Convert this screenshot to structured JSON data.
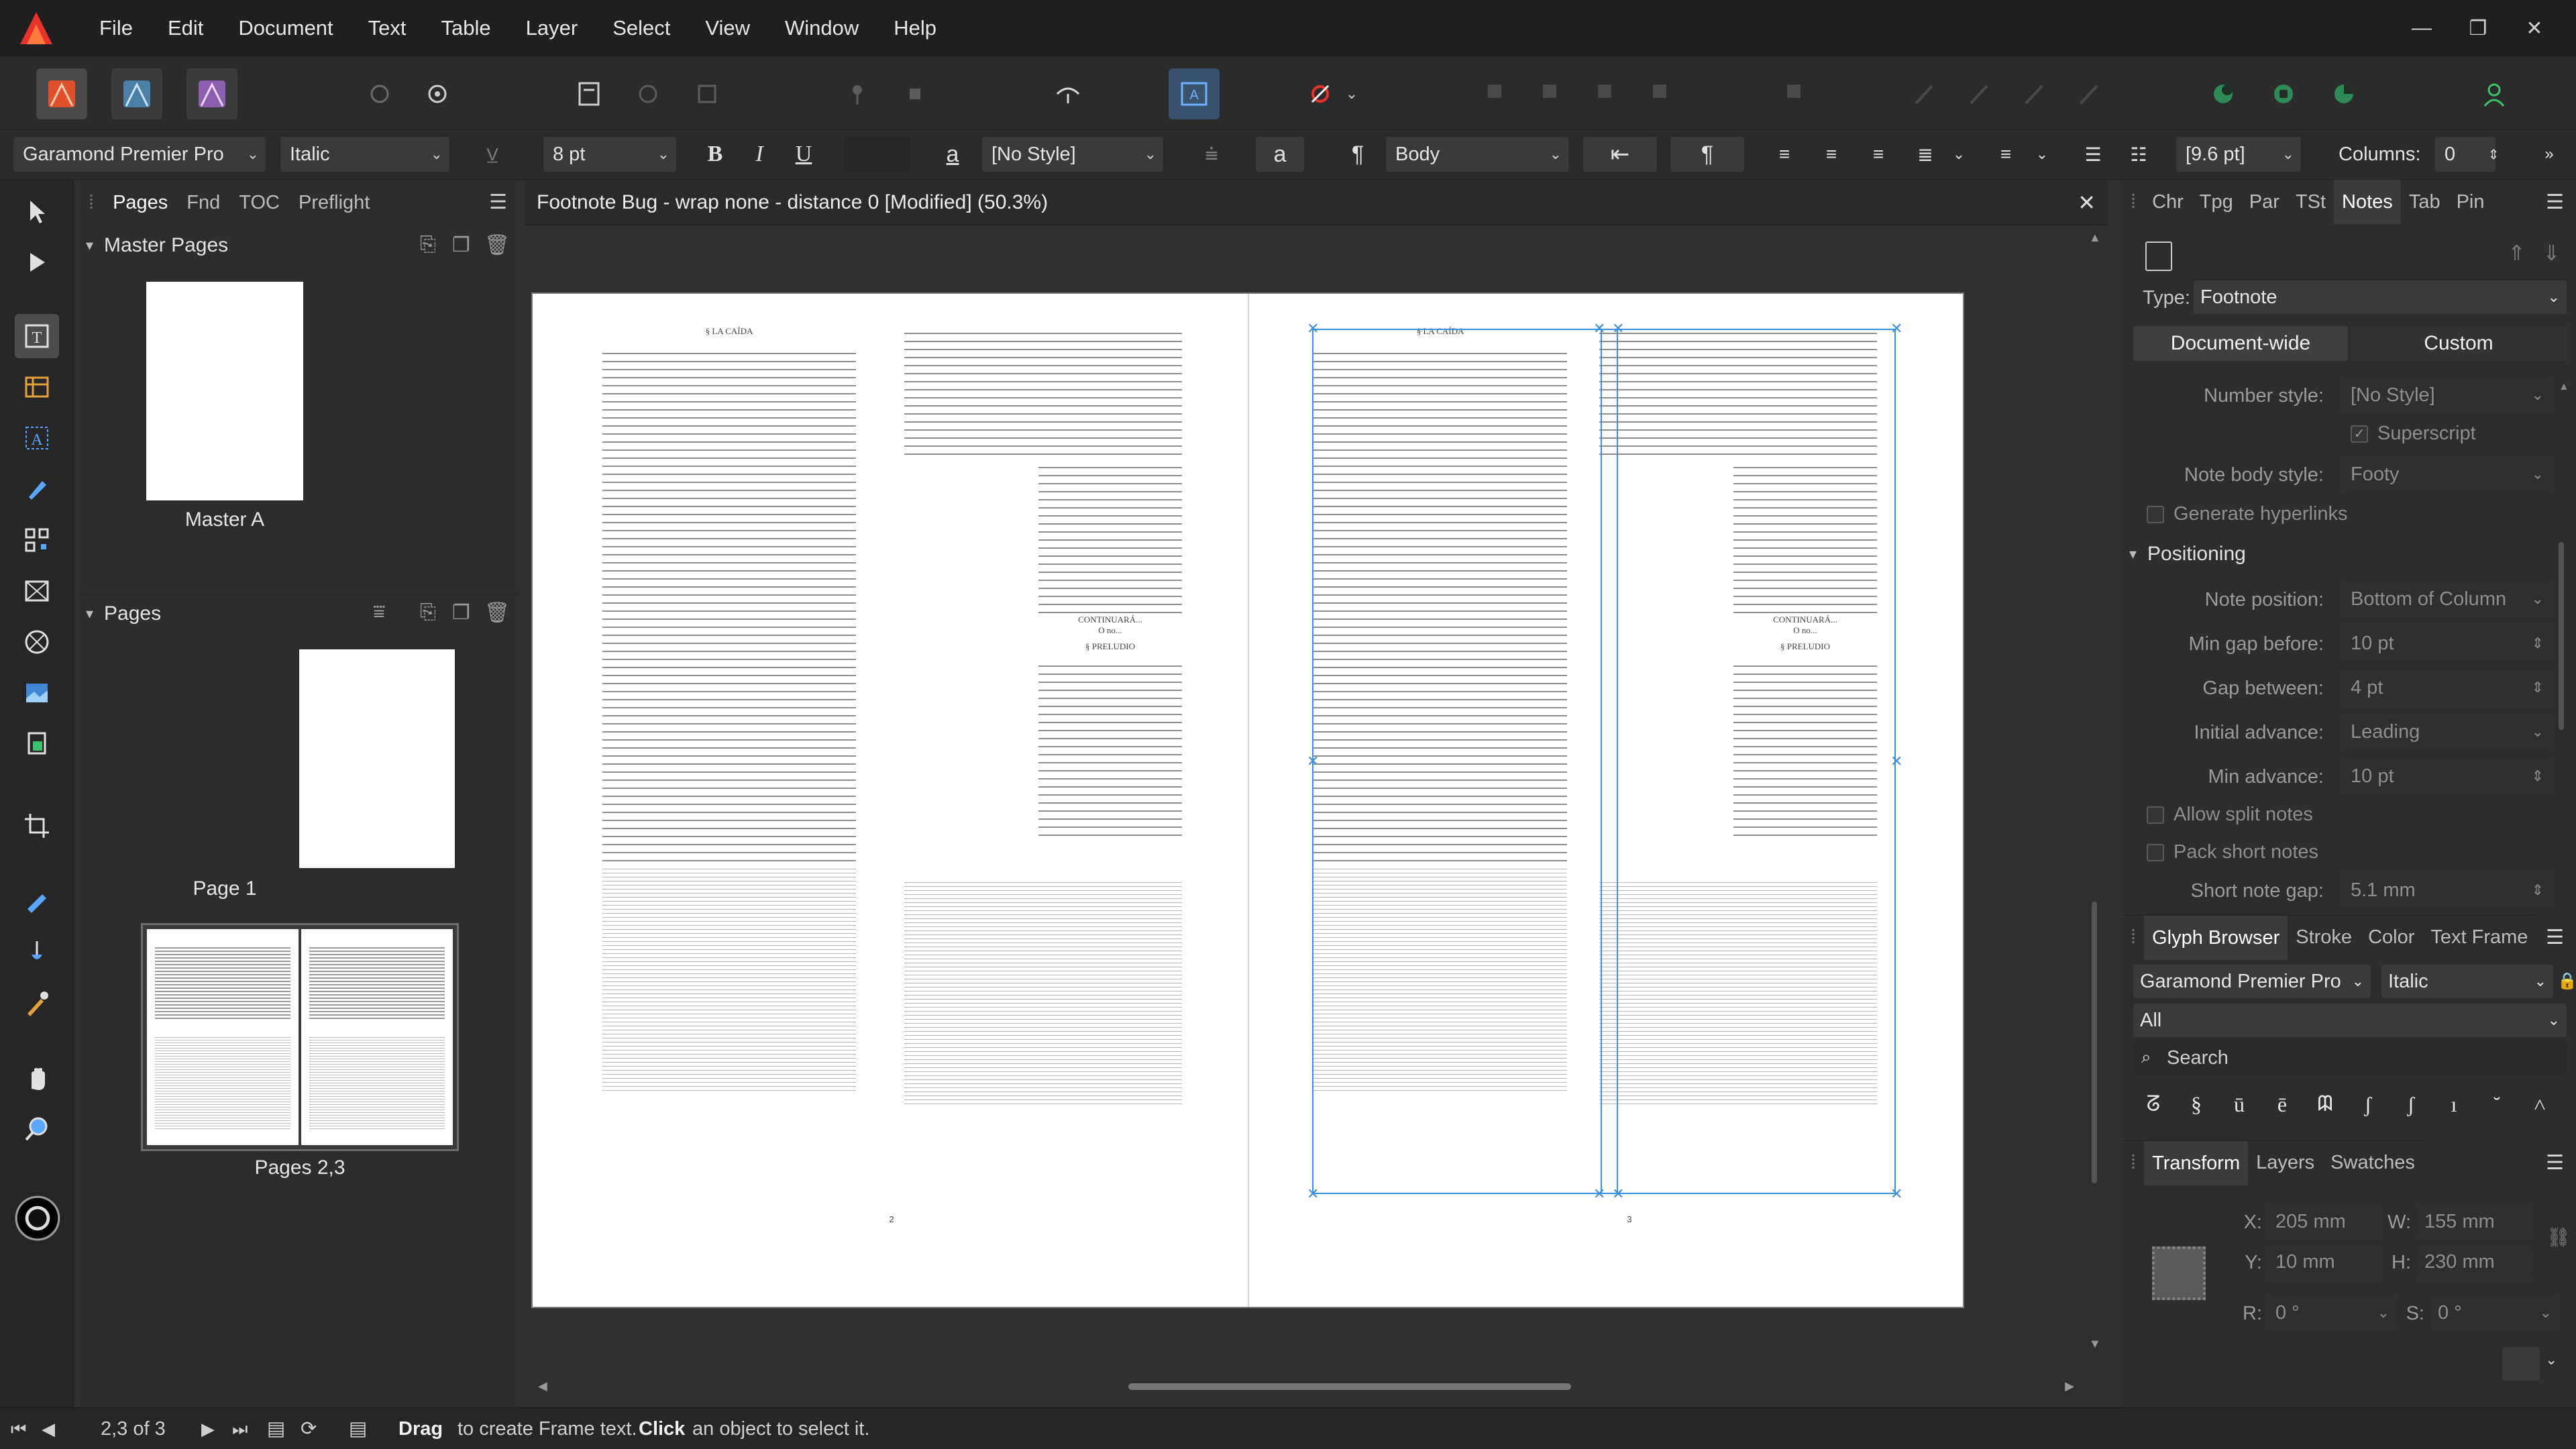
{
  "menubar": {
    "items": [
      "File",
      "Edit",
      "Document",
      "Text",
      "Table",
      "Layer",
      "Select",
      "View",
      "Window",
      "Help"
    ],
    "window_controls": [
      "minimize",
      "restore",
      "close"
    ]
  },
  "toolbar": {
    "personas": [
      "publisher-persona-icon",
      "designer-persona-icon",
      "photo-persona-icon"
    ],
    "icons": [
      "spread-setup-icon",
      "preferences-icon",
      "pages-icon",
      "master-icon",
      "baseline-icon",
      "pin-icon",
      "frame-icon",
      "preflight-icon",
      "text-frame-icon",
      "no-link-icon",
      "arrange-icon",
      "align-icon",
      "boolean-icon",
      "transform-icon",
      "snapping-icon",
      "assistant-icon",
      "user-icon"
    ]
  },
  "contextbar": {
    "font_family": "Garamond Premier Pro",
    "font_style": "Italic",
    "font_size": "8 pt",
    "bold": "B",
    "italic": "I",
    "underline": "U",
    "char_style": "[No Style]",
    "para_style": "Body",
    "leading": "[9.6 pt]",
    "columns_label": "Columns:",
    "columns_value": "0"
  },
  "left_panel": {
    "tabs": [
      "Pages",
      "Fnd",
      "TOC",
      "Preflight"
    ],
    "active_tab": "Pages",
    "master_header": "Master Pages",
    "pages_header": "Pages",
    "masters": [
      {
        "label": "Master A"
      }
    ],
    "pages": [
      {
        "label": "Page 1"
      },
      {
        "label": "Pages 2,3"
      }
    ]
  },
  "document": {
    "title": "Footnote Bug - wrap none - distance 0 [Modified] (50.3%)",
    "left_page_number": "2",
    "right_page_number": "3",
    "heading_caida": "§ LA CAÍDA",
    "heading_preludio": "§ PRELUDIO",
    "continuara": "CONTINUARÁ...",
    "ono": "O no..."
  },
  "right_panel": {
    "tabs": [
      "Chr",
      "Tpg",
      "Par",
      "TSt",
      "Notes",
      "Tab",
      "Pin"
    ],
    "active_tab": "Notes",
    "type_label": "Type:",
    "type_value": "Footnote",
    "scope_buttons": [
      "Document-wide",
      "Custom"
    ],
    "number_style_label": "Number style:",
    "number_style_value": "[No Style]",
    "superscript_label": "Superscript",
    "note_body_style_label": "Note body style:",
    "note_body_style_value": "Footy",
    "generate_hyperlinks_label": "Generate hyperlinks",
    "positioning_header": "Positioning",
    "note_position_label": "Note position:",
    "note_position_value": "Bottom of Column",
    "min_gap_label": "Min gap before:",
    "min_gap_value": "10 pt",
    "gap_between_label": "Gap between:",
    "gap_between_value": "4 pt",
    "initial_advance_label": "Initial advance:",
    "initial_advance_value": "Leading",
    "min_advance_label": "Min advance:",
    "min_advance_value": "10 pt",
    "allow_split_label": "Allow split notes",
    "pack_short_label": "Pack short notes",
    "short_gap_label": "Short note gap:",
    "short_gap_value": "5.1 mm",
    "glyph_tabs": [
      "Glyph Browser",
      "Stroke",
      "Color",
      "Text Frame"
    ],
    "glyph_font": "Garamond Premier Pro",
    "glyph_style": "Italic",
    "glyph_subset": "All",
    "glyph_search_placeholder": "Search",
    "glyphs": [
      "ᘔ",
      "§",
      "ū",
      "ē",
      "ᗼ",
      "ʃ",
      "ʃ",
      "ı",
      "˘",
      "˄"
    ],
    "transform_tabs": [
      "Transform",
      "Layers",
      "Swatches"
    ],
    "x_label": "X:",
    "x_value": "205 mm",
    "y_label": "Y:",
    "y_value": "10 mm",
    "w_label": "W:",
    "w_value": "155 mm",
    "h_label": "H:",
    "h_value": "230 mm",
    "r_label": "R:",
    "r_value": "0 °",
    "s_label": "S:",
    "s_value": "0 °"
  },
  "statusbar": {
    "page_indicator": "2,3 of 3",
    "hint_bold1": "Drag",
    "hint_text1": "to create Frame text.",
    "hint_bold2": "Click",
    "hint_text2": "an object to select it."
  },
  "colors": {
    "accent_red": "#e7332a",
    "selection_blue": "#3b8fe0",
    "panel_bg": "#2d2d2d"
  }
}
